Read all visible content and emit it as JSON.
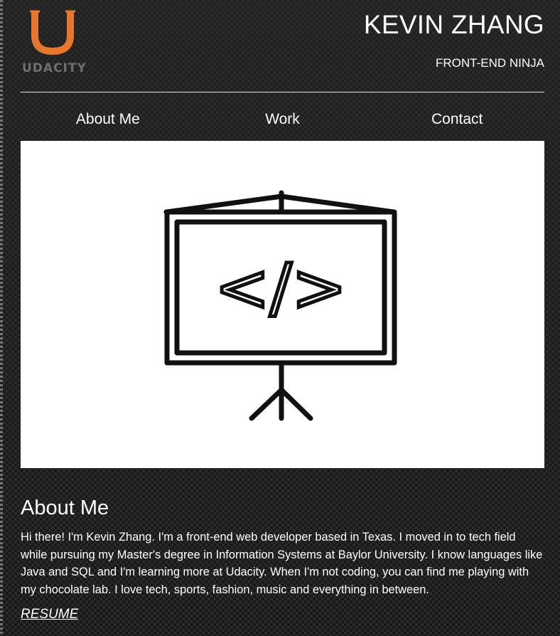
{
  "header": {
    "logo_text": "UDACITY",
    "name": "KEVIN ZHANG",
    "title": "FRONT-END NINJA"
  },
  "nav": {
    "items": [
      {
        "label": "About Me"
      },
      {
        "label": "Work"
      },
      {
        "label": "Contact"
      }
    ]
  },
  "hero": {
    "icon": "presentation-code-icon",
    "glyph": "</>"
  },
  "about": {
    "heading": "About Me",
    "text": "Hi there! I'm Kevin Zhang. I'm a front-end web developer based in Texas. I moved in to tech field while pursuing my Master's degree in Information Systems at Baylor University. I know languages like Java and SQL and I'm learning more at Udacity. When I'm not coding, you can find me playing with my chocolate lab. I love tech, sports, fashion, music and everything in between.",
    "resume_label": "RESUME"
  },
  "colors": {
    "logo_orange": "#e8772e",
    "logo_gray": "#6f6f6f",
    "text": "#ffffff",
    "background": "#1a1a1a"
  }
}
